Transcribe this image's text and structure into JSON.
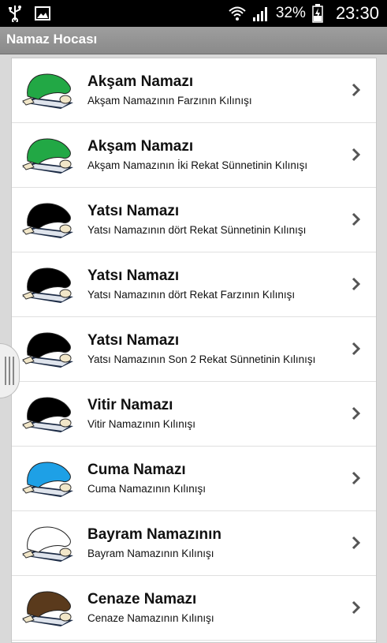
{
  "status": {
    "battery": "32%",
    "time": "23:30"
  },
  "app": {
    "title": "Namaz Hocası"
  },
  "colors": {
    "green": "#22a845",
    "black": "#000000",
    "blue": "#1ea0e6",
    "white": "#ffffff",
    "brown": "#5a3a1c"
  },
  "items": [
    {
      "title": "Akşam Namazı",
      "subtitle": "Akşam Namazının Farzının Kılınışı",
      "color": "#22a845"
    },
    {
      "title": "Akşam Namazı",
      "subtitle": "Akşam Namazının İki Rekat Sünnetinin Kılınışı",
      "color": "#22a845"
    },
    {
      "title": "Yatsı Namazı",
      "subtitle": "Yatsı Namazının dört Rekat Sünnetinin Kılınışı",
      "color": "#000000"
    },
    {
      "title": "Yatsı Namazı",
      "subtitle": "Yatsı Namazının dört Rekat Farzının Kılınışı",
      "color": "#000000"
    },
    {
      "title": "Yatsı Namazı",
      "subtitle": "Yatsı Namazının Son 2 Rekat Sünnetinin Kılınışı",
      "color": "#000000"
    },
    {
      "title": "Vitir Namazı",
      "subtitle": "Vitir Namazının Kılınışı",
      "color": "#000000"
    },
    {
      "title": "Cuma Namazı",
      "subtitle": "Cuma Namazının Kılınışı",
      "color": "#1ea0e6"
    },
    {
      "title": "Bayram Namazının",
      "subtitle": "Bayram Namazının Kılınışı",
      "color": "#ffffff"
    },
    {
      "title": "Cenaze Namazı",
      "subtitle": "Cenaze Namazının Kılınışı",
      "color": "#5a3a1c"
    }
  ]
}
